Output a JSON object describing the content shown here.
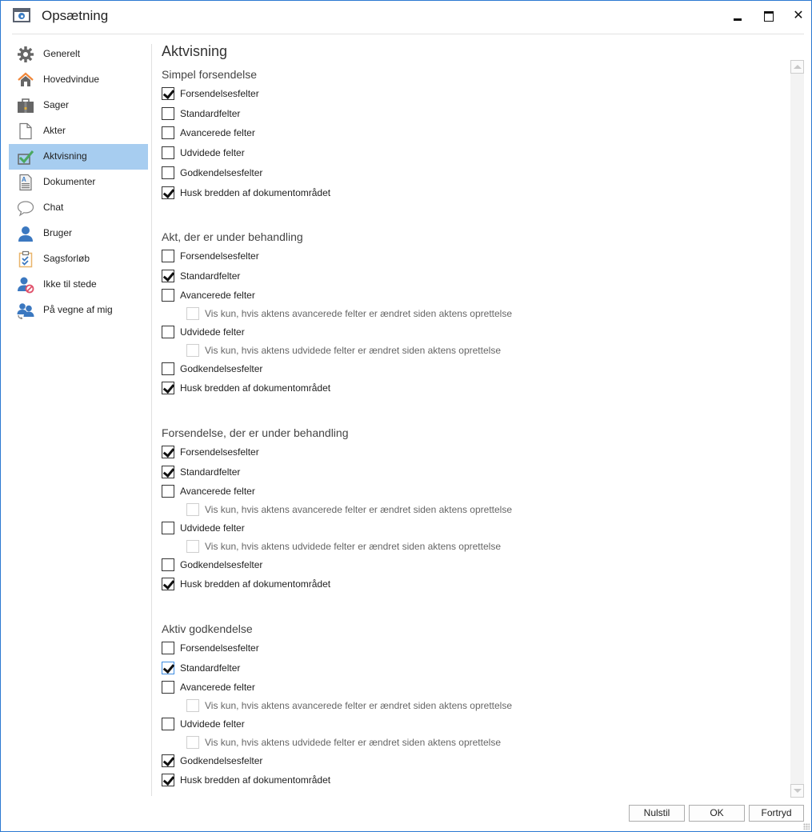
{
  "window": {
    "title": "Opsætning",
    "controls": {
      "minimize": "minimize",
      "maximize": "maximize",
      "close": "✕"
    }
  },
  "colors": {
    "window_border": "#2b79d1",
    "selected_nav_bg": "#a7cdf0",
    "focus_blue": "#3c8ae0"
  },
  "sidebar": {
    "items": [
      {
        "label": "Generelt",
        "icon": "gear-icon",
        "active": false
      },
      {
        "label": "Hovedvindue",
        "icon": "home-icon",
        "active": false
      },
      {
        "label": "Sager",
        "icon": "briefcase-icon",
        "active": false
      },
      {
        "label": "Akter",
        "icon": "document-icon",
        "active": false
      },
      {
        "label": "Aktvisning",
        "icon": "checkbox-check-icon",
        "active": true
      },
      {
        "label": "Dokumenter",
        "icon": "text-document-icon",
        "active": false
      },
      {
        "label": "Chat",
        "icon": "speech-bubble-icon",
        "active": false
      },
      {
        "label": "Bruger",
        "icon": "user-icon",
        "active": false
      },
      {
        "label": "Sagsforløb",
        "icon": "clipboard-checklist-icon",
        "active": false
      },
      {
        "label": "Ikke til stede",
        "icon": "user-away-icon",
        "active": false
      },
      {
        "label": "På vegne af mig",
        "icon": "users-delegate-icon",
        "active": false
      }
    ]
  },
  "content": {
    "title": "Aktvisning",
    "groups": [
      {
        "title": "Simpel forsendelse",
        "options": [
          {
            "label": "Forsendelsesfelter",
            "checked": true
          },
          {
            "label": "Standardfelter",
            "checked": false
          },
          {
            "label": "Avancerede felter",
            "checked": false
          },
          {
            "label": "Udvidede felter",
            "checked": false
          },
          {
            "label": "Godkendelsesfelter",
            "checked": false
          },
          {
            "label": "Husk bredden af dokumentområdet",
            "checked": true
          }
        ]
      },
      {
        "title": "Akt, der er under behandling",
        "options": [
          {
            "label": "Forsendelsesfelter",
            "checked": false
          },
          {
            "label": "Standardfelter",
            "checked": true
          },
          {
            "label": "Avancerede felter",
            "checked": false
          },
          {
            "label": "Vis kun, hvis aktens avancerede felter er ændret siden aktens oprettelse",
            "checked": false,
            "sub": true,
            "disabled": true
          },
          {
            "label": "Udvidede felter",
            "checked": false
          },
          {
            "label": "Vis kun, hvis aktens udvidede felter er ændret siden aktens oprettelse",
            "checked": false,
            "sub": true,
            "disabled": true
          },
          {
            "label": "Godkendelsesfelter",
            "checked": false
          },
          {
            "label": "Husk bredden af dokumentområdet",
            "checked": true
          }
        ]
      },
      {
        "title": "Forsendelse, der er under behandling",
        "options": [
          {
            "label": "Forsendelsesfelter",
            "checked": true
          },
          {
            "label": "Standardfelter",
            "checked": true
          },
          {
            "label": "Avancerede felter",
            "checked": false
          },
          {
            "label": "Vis kun, hvis aktens avancerede felter er ændret siden aktens oprettelse",
            "checked": false,
            "sub": true,
            "disabled": true
          },
          {
            "label": "Udvidede felter",
            "checked": false
          },
          {
            "label": "Vis kun, hvis aktens udvidede felter er ændret siden aktens oprettelse",
            "checked": false,
            "sub": true,
            "disabled": true
          },
          {
            "label": "Godkendelsesfelter",
            "checked": false
          },
          {
            "label": "Husk bredden af dokumentområdet",
            "checked": true
          }
        ]
      },
      {
        "title": "Aktiv godkendelse",
        "options": [
          {
            "label": "Forsendelsesfelter",
            "checked": false
          },
          {
            "label": "Standardfelter",
            "checked": true,
            "focused": true
          },
          {
            "label": "Avancerede felter",
            "checked": false
          },
          {
            "label": "Vis kun, hvis aktens avancerede felter er ændret siden aktens oprettelse",
            "checked": false,
            "sub": true,
            "disabled": true
          },
          {
            "label": "Udvidede felter",
            "checked": false
          },
          {
            "label": "Vis kun, hvis aktens udvidede felter er ændret siden aktens oprettelse",
            "checked": false,
            "sub": true,
            "disabled": true
          },
          {
            "label": "Godkendelsesfelter",
            "checked": true
          },
          {
            "label": "Husk bredden af dokumentområdet",
            "checked": true
          }
        ]
      }
    ]
  },
  "footer": {
    "reset_label": "Nulstil",
    "ok_label": "OK",
    "cancel_label": "Fortryd"
  }
}
